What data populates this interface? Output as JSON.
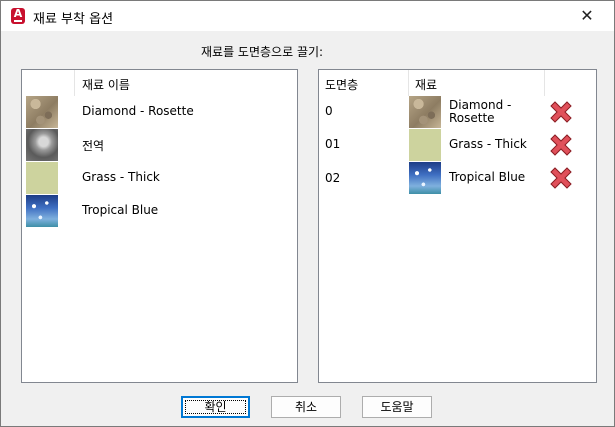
{
  "window": {
    "title": "재료 부착 옵션",
    "close_glyph": "✕",
    "app_icon_letter": "A"
  },
  "instruction": "재료를 도면층으로 끌기:",
  "left_panel": {
    "header_name": "재료 이름",
    "items": [
      {
        "name": "Diamond - Rosette",
        "swatch": "diamond-rosette"
      },
      {
        "name": "전역",
        "swatch": "generic-sphere"
      },
      {
        "name": "Grass - Thick",
        "swatch": "grass-thick"
      },
      {
        "name": "Tropical Blue",
        "swatch": "tropical-blue"
      }
    ]
  },
  "right_panel": {
    "header_layer": "도면층",
    "header_material": "재료",
    "rows": [
      {
        "layer": "0",
        "material_line1": "Diamond -",
        "material_line2": "Rosette",
        "swatch": "diamond-rosette",
        "action_icon": "detach-x-icon"
      },
      {
        "layer": "01",
        "material_line1": "Grass - Thick",
        "material_line2": "",
        "swatch": "grass-thick",
        "action_icon": "detach-x-icon"
      },
      {
        "layer": "02",
        "material_line1": "Tropical Blue",
        "material_line2": "",
        "swatch": "tropical-blue",
        "action_icon": "detach-x-icon"
      }
    ]
  },
  "buttons": {
    "ok": "확인",
    "cancel": "취소",
    "help": "도움말"
  },
  "colors": {
    "app_icon": "#c8102e",
    "delete_x": "#e0505a",
    "focus_border": "#0078d4"
  }
}
